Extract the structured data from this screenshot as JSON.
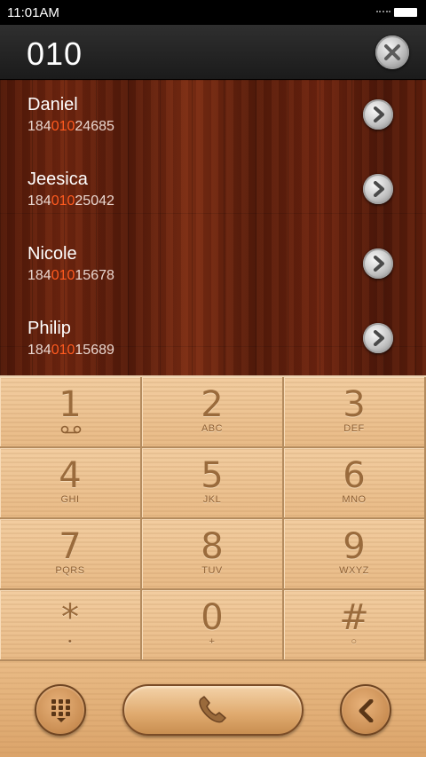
{
  "status_bar": {
    "time": "11:01AM"
  },
  "dialer": {
    "number": "010",
    "clear_icon": "close-icon"
  },
  "contacts": [
    {
      "name": "Daniel",
      "number_prefix": "184",
      "number_match": "010",
      "number_suffix": "24685",
      "action_icon": "chevron-right-icon"
    },
    {
      "name": "Jeesica",
      "number_prefix": "184",
      "number_match": "010",
      "number_suffix": "25042",
      "action_icon": "chevron-right-icon"
    },
    {
      "name": "Nicole",
      "number_prefix": "184",
      "number_match": "010",
      "number_suffix": "15678",
      "action_icon": "chevron-right-icon"
    },
    {
      "name": "Philip",
      "number_prefix": "184",
      "number_match": "010",
      "number_suffix": "15689",
      "action_icon": "chevron-right-icon"
    }
  ],
  "keypad": [
    {
      "digit": "1",
      "letters": ""
    },
    {
      "digit": "2",
      "letters": "ABC"
    },
    {
      "digit": "3",
      "letters": "DEF"
    },
    {
      "digit": "4",
      "letters": "GHI"
    },
    {
      "digit": "5",
      "letters": "JKL"
    },
    {
      "digit": "6",
      "letters": "MNO"
    },
    {
      "digit": "7",
      "letters": "PQRS"
    },
    {
      "digit": "8",
      "letters": "TUV"
    },
    {
      "digit": "9",
      "letters": "WXYZ"
    },
    {
      "digit": "*",
      "letters": "•"
    },
    {
      "digit": "0",
      "letters": "+"
    },
    {
      "digit": "#",
      "letters": "○"
    }
  ],
  "actions": {
    "keypad_toggle_icon": "keypad-grid-icon",
    "call_icon": "phone-icon",
    "backspace_icon": "backspace-arrow-icon"
  },
  "colors": {
    "match_highlight": "#ff5a1f",
    "header_bg": "#222222",
    "wood_dark": "#5a1c0b",
    "keypad_wood": "#ecbf8c"
  }
}
